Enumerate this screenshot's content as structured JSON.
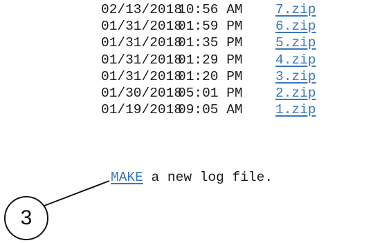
{
  "files": [
    {
      "date": "02/13/2018",
      "time": "10:56 AM",
      "name": "7.zip"
    },
    {
      "date": "01/31/2018",
      "time": "01:59 PM",
      "name": "6.zip"
    },
    {
      "date": "01/31/2018",
      "time": "01:35 PM",
      "name": "5.zip"
    },
    {
      "date": "01/31/2018",
      "time": "01:29 PM",
      "name": "4.zip"
    },
    {
      "date": "01/31/2018",
      "time": "01:20 PM",
      "name": "3.zip"
    },
    {
      "date": "01/30/2018",
      "time": "05:01 PM",
      "name": "2.zip"
    },
    {
      "date": "01/19/2018",
      "time": "09:05 AM",
      "name": "1.zip"
    }
  ],
  "make": {
    "link_label": "MAKE",
    "rest_text": " a new log file."
  },
  "callout": {
    "number": "3"
  },
  "colors": {
    "link": "#3a78b8",
    "text": "#1a1a1a"
  }
}
